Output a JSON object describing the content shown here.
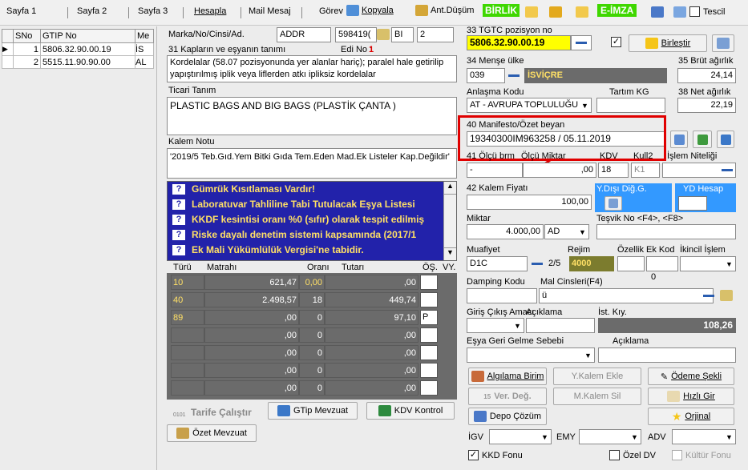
{
  "toolbar": {
    "tabs": [
      "Sayfa 1",
      "Sayfa 2",
      "Sayfa 3",
      "Hesapla",
      "Mail Mesaj",
      "Görev"
    ],
    "kopyala": "Kopyala",
    "ant_dusum": "Ant.Düşüm",
    "birlik": "BİRLİK",
    "eimza": "E-İMZA",
    "tescil": "Tescil"
  },
  "left_grid": {
    "headers": [
      "SNo",
      "GTIP No",
      "Me"
    ],
    "rows": [
      [
        "1",
        "5806.32.90.00.19",
        "İS"
      ],
      [
        "2",
        "5515.11.90.90.00",
        "AL"
      ]
    ]
  },
  "form": {
    "marka_label": "Marka/No/Cinsi/Ad.",
    "marka_value": "ADDR",
    "marka_no": "598419(",
    "marka_bi": "BI",
    "marka_num": "2",
    "kap_label": "31 Kapların ve eşyanın tanımı",
    "edi_label": "Edi No :",
    "edi_value": "1",
    "kap_text": "Kordelalar (58.07 pozisyonunda yer alanlar hariç); paralel hale getirilip yapıştırılmış iplik veya liflerden atkı ipliksiz kordelalar",
    "ticari_label": "Ticari Tanım",
    "ticari_text": "PLASTIC BAGS AND BIG BAGS  (PLASTİK ÇANTA )",
    "kalem_label": "Kalem Notu",
    "kalem_text": "'2019/5 Teb.Gıd.Yem Bitki Gıda Tem.Eden Mad.Ek Listeler Kap.Değildir'",
    "warnings": [
      "Gümrük Kısıtlaması Vardır!",
      "Laboratuvar Tahliline Tabi Tutulacak Eşya Listesi",
      "KKDF kesintisi oranı %0 (sıfır) olarak tespit edilmiş",
      "Riske dayalı denetim sistemi kapsamında (2017/1",
      "Ek Mali Yükümlülük Vergisi'ne tabidir."
    ],
    "tax_headers": [
      "Türü",
      "Matrahı",
      "Oranı",
      "Tutarı",
      "ÖŞ.",
      "VY."
    ],
    "tax_rows": [
      [
        "10",
        "621,47",
        "0,00",
        ",00",
        ""
      ],
      [
        "40",
        "2.498,57",
        "18",
        "449,74",
        ""
      ],
      [
        "89",
        ",00",
        "0",
        "97,10",
        "P"
      ],
      [
        "",
        ",00",
        "0",
        ",00",
        ""
      ],
      [
        "",
        ",00",
        "0",
        ",00",
        ""
      ],
      [
        "",
        ",00",
        "0",
        ",00",
        ""
      ],
      [
        "",
        ",00",
        "0",
        ",00",
        ""
      ]
    ],
    "tarife": "Tarife Çalıştır",
    "tarife_prefix": "0101",
    "gtip_mevzuat": "GTip Mevzuat",
    "kdv_kontrol": "KDV Kontrol",
    "ozet_mevzuat": "Özet Mevzuat"
  },
  "right": {
    "tgtc_label": "33 TGTC pozisyon no",
    "tgtc_value": "5806.32.90.00.19",
    "birlestir": "Birleştir",
    "mense_label": "34 Menşe ülke",
    "mense_code": "039",
    "mense_name": "İSVİÇRE",
    "brut_label": "35 Brüt ağırlık",
    "brut_value": "24,14",
    "anlasma_label": "Anlaşma Kodu",
    "anlasma_value": "AT    - AVRUPA TOPLULUĞU",
    "tartim_label": "Tartım KG",
    "net_label": "38 Net ağırlık",
    "net_value": "22,19",
    "manifesto_label": "40 Manifesto/Özet beyan",
    "manifesto_value": "19340300IM963258 / 05.11.2019",
    "olcu_labels": [
      "41 Ölçü brm",
      "Ölçü Miktar",
      "KDV",
      "Kull2",
      "İşlem Niteliği"
    ],
    "olcu_brm": "-",
    "olcu_miktar": ",00",
    "kdv": "18",
    "kull2": "K1",
    "kalem_fiyati_label": "42 Kalem Fiyatı",
    "kalem_fiyati": "100,00",
    "ydisi_label": "Y.Dışı Diğ.G.",
    "yd_hesap_label": "YD Hesap",
    "miktar_label": "Miktar",
    "miktar_value": "4.000,00",
    "miktar_unit": "AD",
    "tesvik_label": "Teşvik No <F4>, <F8>",
    "muafiyet_label": "Muafiyet",
    "rejim_label": "Rejim",
    "ozellik_label": "Özellik",
    "ek_kod_label": "Ek Kod",
    "ikincil_label": "İkincil İşlem",
    "muafiyet_value": "D1C",
    "rejim_fraction": "2/5",
    "rejim_value": "4000",
    "damping_label": "Damping Kodu",
    "mal_cinsleri_label": "Mal Cinsleri(F4)",
    "mal_count": "0",
    "mal_value": "ü",
    "giris_label": "Giriş Çıkış Amacı",
    "aciklama_label": "Açıklama",
    "ist_label": "İst. Kıy.",
    "ist_value": "108,26",
    "esya_label": "Eşya Geri Gelme Sebebi",
    "aciklama2_label": "Açıklama",
    "algilama": "Algılama Birim",
    "ykalem_ekle": "Y.Kalem Ekle",
    "odeme_sekli": "Ödeme Şekli",
    "ver_deg_prefix": "15",
    "ver_deg": "Ver. Değ.",
    "mkalem_sil": "M.Kalem Sil",
    "hizli_gir": "Hızlı Gir",
    "depo_cozum": "Depo Çözüm",
    "orjinal": "Orjinal",
    "igv_label": "İGV",
    "emy_label": "EMY",
    "adv_label": "ADV",
    "kkd_fonu": "KKD Fonu",
    "ozel_dv": "Özel DV",
    "kultur_fonu": "Kültür Fonu"
  },
  "colors": {
    "highlight": "#ffff00",
    "navy": "#2222aa",
    "olive": "#7c7c2e",
    "gray_dark": "#6b6b6b",
    "red": "#e00000",
    "green": "#3fd700",
    "blue": "#3399ff"
  }
}
